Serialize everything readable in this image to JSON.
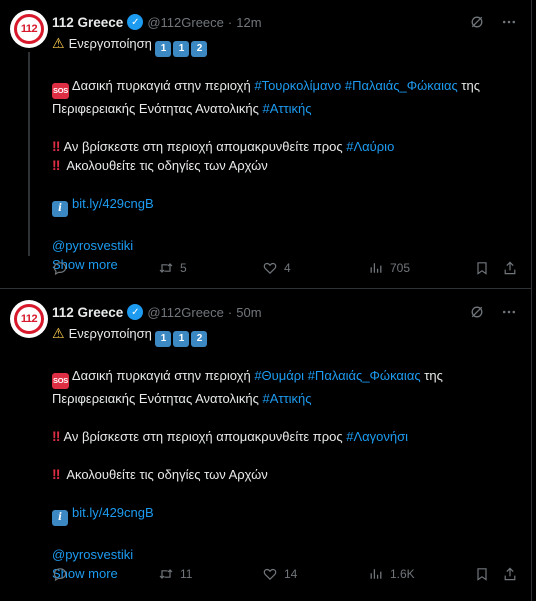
{
  "tweets": [
    {
      "author": {
        "name": "112 Greece",
        "handle": "@112Greece",
        "time": "12m",
        "avatar_text": "112"
      },
      "line_activation": "Ενεργοποίηση",
      "keycaps": [
        "1",
        "1",
        "2"
      ],
      "fire_text": "Δασική πυρκαγιά στην περιοχή",
      "place_tag": "#Τουρκολίμανο",
      "area_tag": "#Παλαιάς_Φώκαιας",
      "of_the": "της",
      "region_text": "Περιφερειακής Ενότητας Ανατολικής",
      "region_tag": "#Αττικής",
      "evacuate_text": "Αν βρίσκεστε στη περιοχή απομακρυνθείτε προς",
      "evacuate_tag": "#Λαύριο",
      "follow_text": "Ακολουθείτε τις οδηγίες των Αρχών",
      "link": "bit.ly/429cngB",
      "mention": "@pyrosvestiki",
      "show_more": "Show more",
      "stats": {
        "replies": "",
        "retweets": "5",
        "likes": "4",
        "views": "705"
      }
    },
    {
      "author": {
        "name": "112 Greece",
        "handle": "@112Greece",
        "time": "50m",
        "avatar_text": "112"
      },
      "line_activation": "Ενεργοποίηση",
      "keycaps": [
        "1",
        "1",
        "2"
      ],
      "fire_text": "Δασική πυρκαγιά στην περιοχή",
      "place_tag": "#Θυμάρι",
      "area_tag": "#Παλαιάς_Φώκαιας",
      "of_the": "της",
      "region_text": "Περιφερειακής Ενότητας Ανατολικής",
      "region_tag": "#Αττικής",
      "evacuate_text": "Αν βρίσκεστε στη περιοχή απομακρυνθείτε προς",
      "evacuate_tag": "#Λαγονήσι",
      "follow_text": "Ακολουθείτε τις οδηγίες των Αρχών",
      "link": "bit.ly/429cngB",
      "mention": "@pyrosvestiki",
      "show_more": "Show more",
      "stats": {
        "replies": "",
        "retweets": "11",
        "likes": "14",
        "views": "1.6K"
      }
    }
  ],
  "icons": {
    "verified": "verified-badge-icon",
    "grok": "grok-icon",
    "more": "more-icon",
    "reply": "reply-icon",
    "retweet": "retweet-icon",
    "like": "like-icon",
    "views": "views-icon",
    "bookmark": "bookmark-icon",
    "share": "share-icon"
  },
  "emoji": {
    "sos": "SOS",
    "info": "i",
    "warning": "⚠",
    "double_bang": "‼"
  },
  "colors": {
    "background": "#000000",
    "text": "#e7e9ea",
    "muted": "#71767b",
    "link": "#1d9bf0",
    "border": "#2f3336",
    "brand_red": "#d7192b"
  }
}
